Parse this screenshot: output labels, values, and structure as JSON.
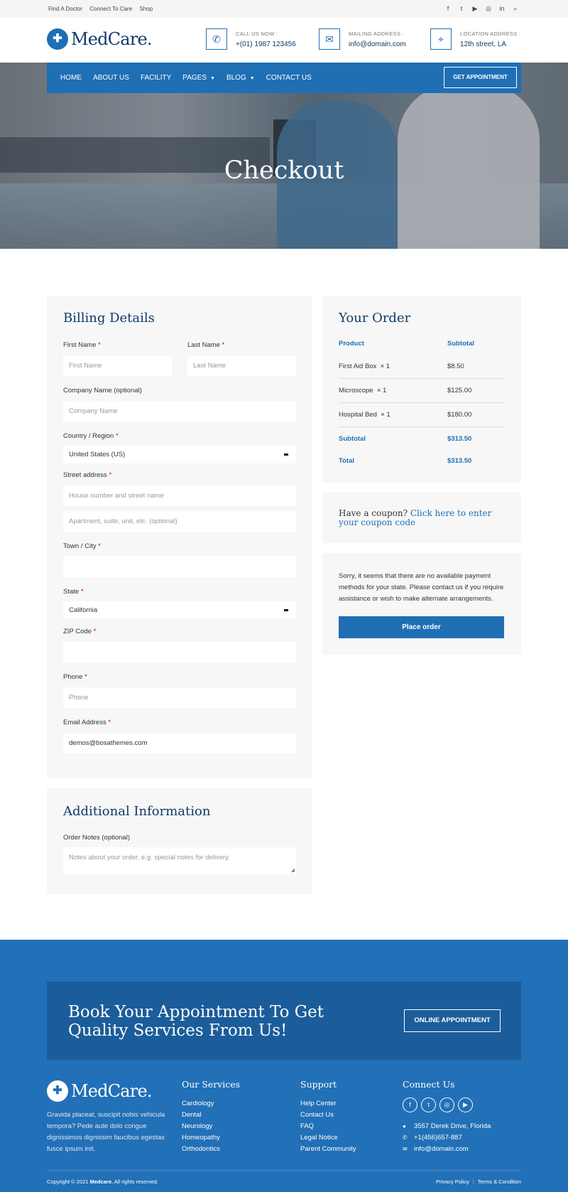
{
  "topbar": {
    "links": [
      "Find A Doctor",
      "Connect To Care",
      "Shop"
    ],
    "social_icons": [
      "facebook-icon",
      "twitter-icon",
      "youtube-icon",
      "instagram-icon",
      "linkedin-icon",
      "search-icon"
    ]
  },
  "header": {
    "logo_text": "MedCare.",
    "call_label": "CALL US NOW :",
    "call_value": "+(01) 1987 123456",
    "mail_label": "MAILING ADDRESS :",
    "mail_value": "info@domain.com",
    "location_label": "LOCATION ADDRESS :",
    "location_value": "12th street, LA"
  },
  "nav": {
    "items": [
      "HOME",
      "ABOUT US",
      "FACILITY",
      "PAGES",
      "BLOG",
      "CONTACT US"
    ],
    "cta": "GET APPOINTMENT"
  },
  "hero": {
    "title": "Checkout"
  },
  "billing": {
    "title": "Billing Details",
    "first_name_label": "First Name",
    "first_name_placeholder": "First Name",
    "last_name_label": "Last Name",
    "last_name_placeholder": "Last Name",
    "company_label": "Company Name (optional)",
    "company_placeholder": "Company Name",
    "country_label": "Country / Region",
    "country_value": "United States (US)",
    "street_label": "Street address",
    "street_placeholder": "House number and street name",
    "apartment_placeholder": "Apartment, suite, unit, etc. (optional)",
    "city_label": "Town / City",
    "state_label": "State",
    "state_value": "California",
    "zip_label": "ZIP Code",
    "phone_label": "Phone",
    "phone_placeholder": "Phone",
    "email_label": "Email Address",
    "email_value": "demos@bosathemes.com",
    "required_mark": "*"
  },
  "additional": {
    "title": "Additional Information",
    "notes_label": "Order Notes (optional)",
    "notes_placeholder": "Notes about your order, e.g. special notes for delivery."
  },
  "order": {
    "title": "Your Order",
    "col_product": "Product",
    "col_subtotal": "Subtotal",
    "items": [
      {
        "name": "First Aid Box",
        "qty": "× 1",
        "price": "$8.50"
      },
      {
        "name": "Microscope",
        "qty": "× 1",
        "price": "$125.00"
      },
      {
        "name": "Hospital Bed",
        "qty": "× 1",
        "price": "$180.00"
      }
    ],
    "subtotal_label": "Subtotal",
    "subtotal_value": "$313.50",
    "total_label": "Total",
    "total_value": "$313.50"
  },
  "coupon": {
    "prefix": "Have a coupon?",
    "link": "Click here to enter your coupon code"
  },
  "payment": {
    "message": "Sorry, it seems that there are no available payment methods for your state. Please contact us if you require assistance or wish to make alternate arrangements.",
    "button": "Place order"
  },
  "cta": {
    "line1": "Book Your Appointment To Get",
    "line2": "Quality Services From Us!",
    "button": "ONLINE APPOINTMENT"
  },
  "footer": {
    "logo_text": "MedCare.",
    "about": "Gravida placeat, suscipit nobis vehicula tempora? Pede aute dolo congue dignissimos dignissim faucibus egestas fusce ipsum init.",
    "services_title": "Our Services",
    "services": [
      "Cardiology",
      "Dental",
      "Neurology",
      "Homeopathy",
      "Orthodontics"
    ],
    "support_title": "Support",
    "support": [
      "Help Center",
      "Contact Us",
      "FAQ",
      "Legal Notice",
      "Parent Community"
    ],
    "connect_title": "Connect Us",
    "social_icons": [
      "facebook-icon",
      "twitter-icon",
      "instagram-icon",
      "youtube-icon"
    ],
    "address": "3557 Derek Drive, Florida",
    "phone": "+1(456)657-887",
    "email": "info@domain.com",
    "copyright_prefix": "Copyright © 2021",
    "copyright_brand": "Medcare.",
    "copyright_suffix": "All rights reserved.",
    "privacy": "Privacy Policy",
    "terms": "Terms & Condition"
  },
  "colors": {
    "primary": "#1f6fb5",
    "navy": "#0f3a68",
    "footer": "#2270b7",
    "panel": "#f7f7f7",
    "required": "#dd0000"
  }
}
